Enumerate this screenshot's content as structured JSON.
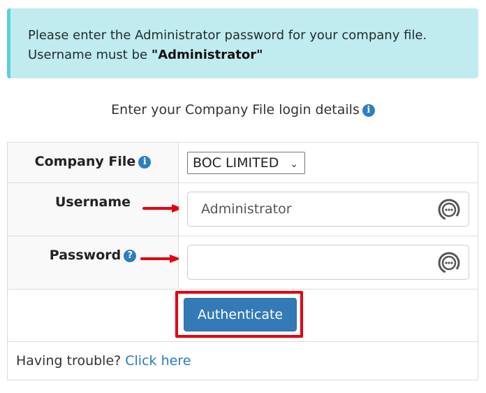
{
  "alert": {
    "line1": "Please enter the Administrator password for your company file.",
    "line2_prefix": "Username must be ",
    "line2_bold": "\"Administrator\""
  },
  "subtitle": "Enter your Company File login details",
  "form": {
    "company_file": {
      "label": "Company File",
      "selected": "BOC LIMITED"
    },
    "username": {
      "label": "Username",
      "value": "Administrator"
    },
    "password": {
      "label": "Password",
      "value": ""
    },
    "authenticate_label": "Authenticate"
  },
  "footer": {
    "prefix": "Having trouble?",
    "link": "Click here"
  },
  "colors": {
    "accent": "#337ab7",
    "alert_bg": "#c1ecef",
    "highlight": "#e4000f"
  },
  "icons": {
    "info": "info-icon",
    "help": "question-icon",
    "password_manager": "password-manager-icon",
    "arrow": "red-arrow-icon"
  }
}
